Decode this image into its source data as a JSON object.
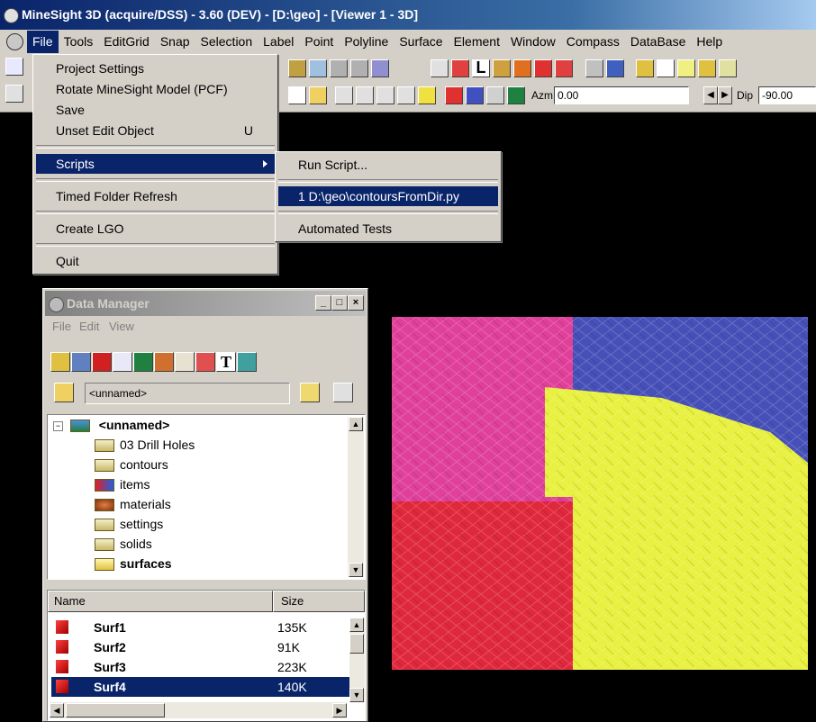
{
  "titlebar": {
    "title": "MineSight 3D  (acquire/DSS) - 3.60 (DEV) - [D:\\geo] - [Viewer 1 - 3D]"
  },
  "menubar": [
    "File",
    "Tools",
    "EditGrid",
    "Snap",
    "Selection",
    "Label",
    "Point",
    "Polyline",
    "Surface",
    "Element",
    "Window",
    "Compass",
    "DataBase",
    "Help"
  ],
  "toolbar": {
    "azm_label": "Azm",
    "azm_value": "0.00",
    "dip_label": "Dip",
    "dip_value": "-90.00"
  },
  "file_menu": {
    "items": [
      "Project Settings",
      "Rotate MineSight Model (PCF)",
      "Save",
      "Unset Edit Object",
      "Scripts",
      "Timed Folder Refresh",
      "Create LGO",
      "Quit"
    ],
    "unset_shortcut": "U"
  },
  "scripts_menu": {
    "items": [
      "Run Script...",
      "1 D:\\geo\\contoursFromDir.py",
      "Automated Tests"
    ]
  },
  "data_manager": {
    "title": "Data Manager",
    "menus": [
      "File",
      "Edit",
      "View"
    ],
    "object_name": "<unnamed>",
    "tree_root": "<unnamed>",
    "folders": [
      "03 Drill Holes",
      "contours",
      "items",
      "materials",
      "settings",
      "solids",
      "surfaces"
    ],
    "columns": {
      "name": "Name",
      "size": "Size"
    },
    "rows": [
      {
        "name": "Surf1",
        "size": "135K"
      },
      {
        "name": "Surf2",
        "size": "91K"
      },
      {
        "name": "Surf3",
        "size": "223K"
      },
      {
        "name": "Surf4",
        "size": "140K"
      }
    ]
  },
  "viewport_colors": {
    "magenta": "#e0409a",
    "blue": "#4650b8",
    "red": "#e0283c",
    "yellow": "#e8f040"
  }
}
